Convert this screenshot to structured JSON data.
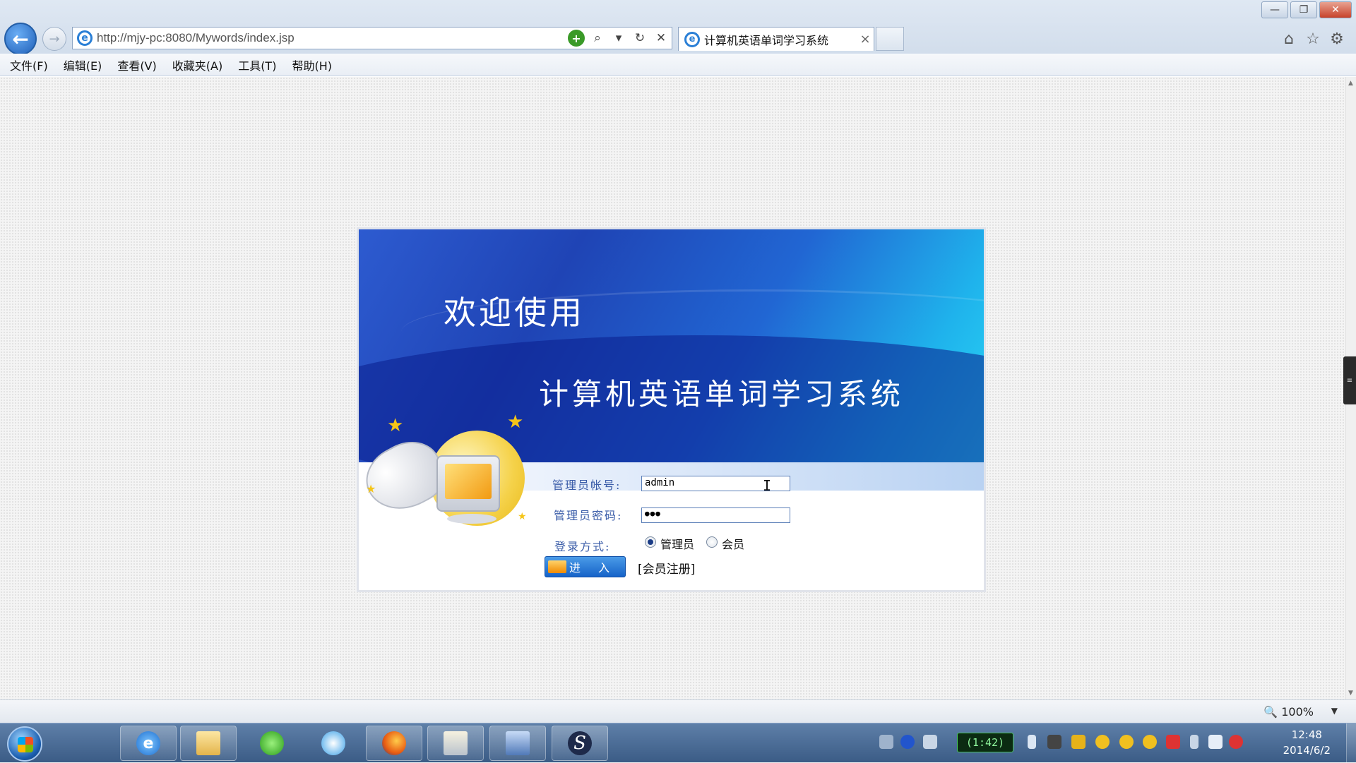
{
  "browser": {
    "url": "http://mjy-pc:8080/Mywords/index.jsp",
    "tab_title": "计算机英语单词学习系统",
    "tab_close": "×",
    "back_glyph": "←",
    "forward_glyph": "→",
    "menu": [
      "文件(F)",
      "编辑(E)",
      "查看(V)",
      "收藏夹(A)",
      "工具(T)",
      "帮助(H)"
    ],
    "window_controls": [
      "—",
      "❐",
      "✕"
    ],
    "zoom": "100%"
  },
  "login": {
    "welcome": "欢迎使用",
    "system_title": "计算机英语单词学习系统",
    "account_label": "管理员帐号:",
    "account_value": "admin",
    "password_label": "管理员密码:",
    "password_value": "●●●",
    "login_mode_label": "登录方式:",
    "role_admin": "管理员",
    "role_member": "会员",
    "selected_role": "管理员",
    "enter_button": "进 入",
    "register_link": "[会员注册]"
  },
  "taskbar": {
    "timer": "(1:42)",
    "time": "12:48",
    "date": "2014/6/2"
  },
  "colors": {
    "banner_dark": "#1f44b5",
    "banner_light": "#2ad5f4",
    "label_blue": "#3a5ca8",
    "button_blue": "#1663c8"
  }
}
